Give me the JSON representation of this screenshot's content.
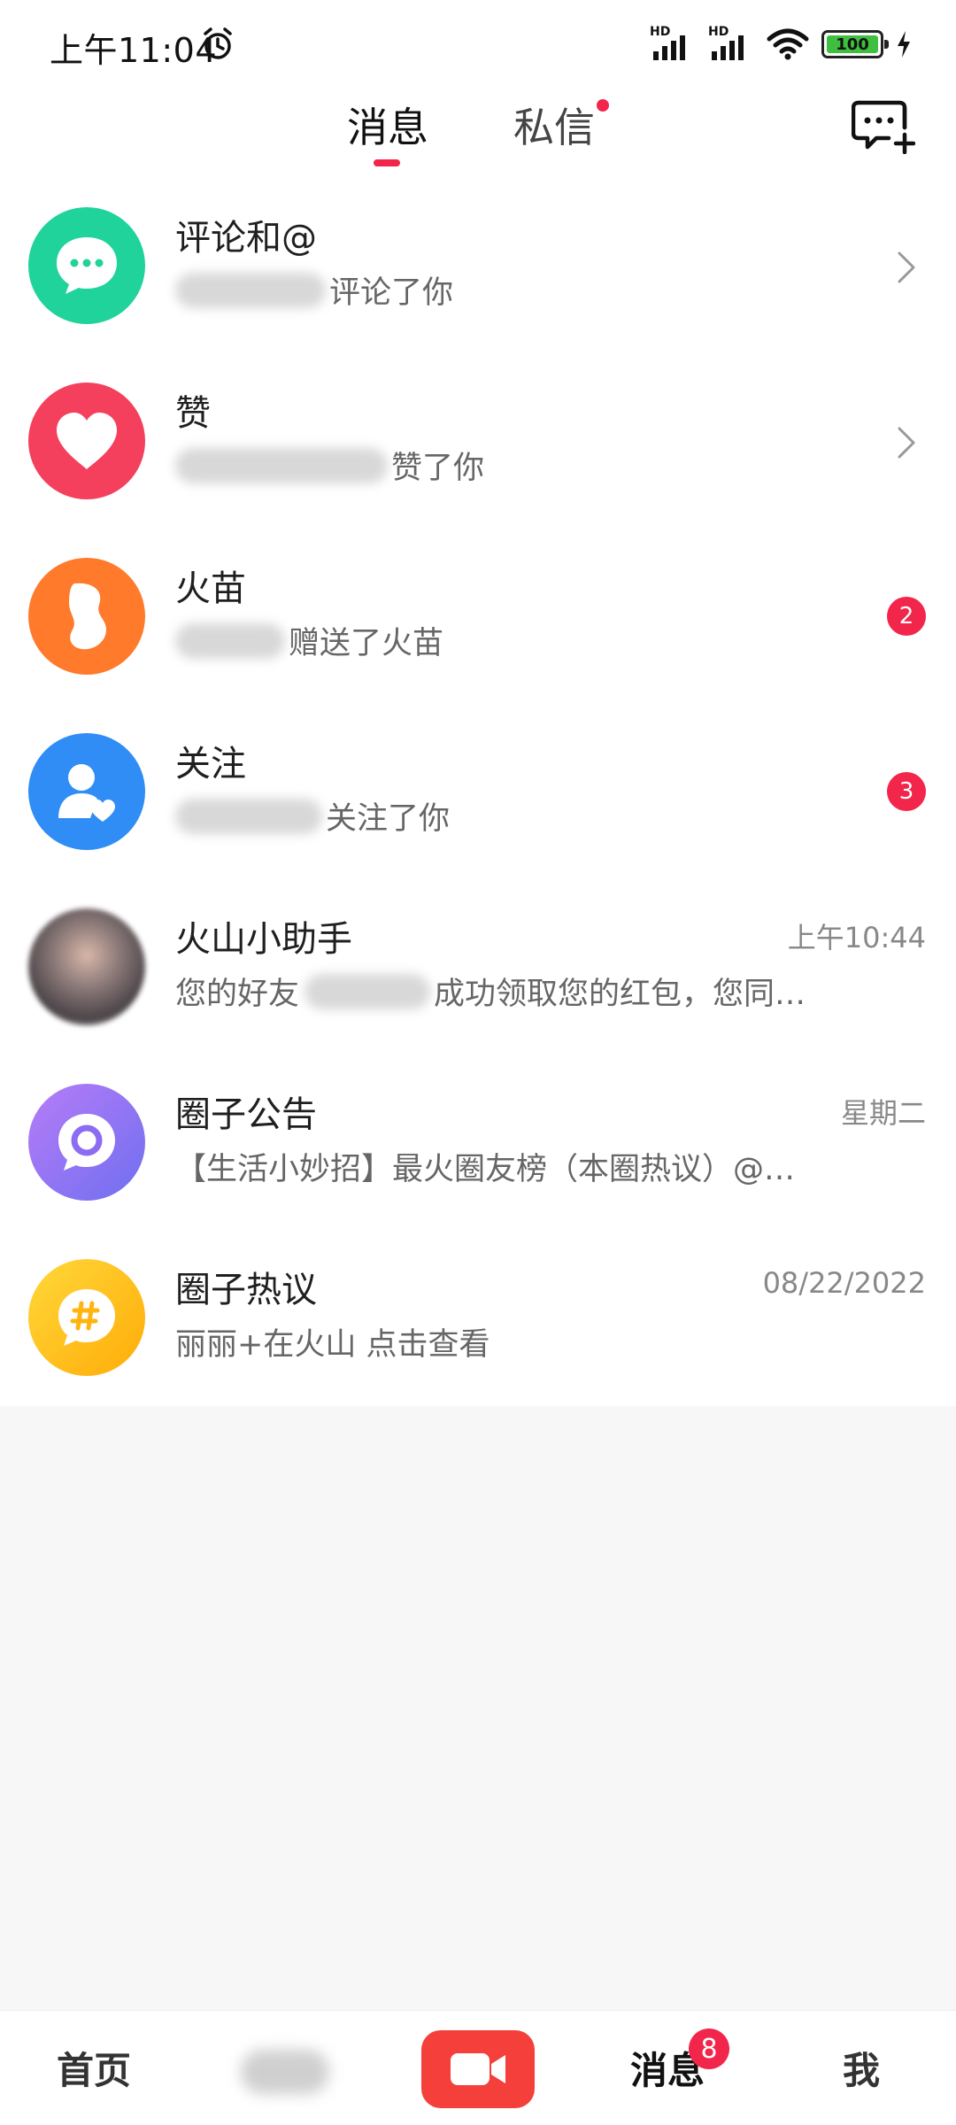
{
  "status_bar": {
    "time": "上午11:04",
    "network_label": "HD",
    "battery_level": "100"
  },
  "header": {
    "tabs": [
      {
        "label": "消息",
        "active": true
      },
      {
        "label": "私信",
        "active": false,
        "has_dot": true
      }
    ]
  },
  "messages": [
    {
      "title": "评论和@",
      "subtitle": "评论了你",
      "icon": "chat-bubble-icon",
      "color": "#1fd39a"
    },
    {
      "title": "赞",
      "subtitle": "赞了你",
      "icon": "heart-icon",
      "color": "#f5405d"
    },
    {
      "title": "火苗",
      "subtitle": "赠送了火苗",
      "icon": "flame-icon",
      "color": "#ff7a2a",
      "badge": "2"
    },
    {
      "title": "关注",
      "subtitle": "关注了你",
      "icon": "follow-user-icon",
      "color": "#2f8df5",
      "badge": "3"
    },
    {
      "title": "火山小助手",
      "subtitle_prefix": "您的好友",
      "subtitle": "成功领取您的红包，您同…",
      "time": "上午10:44"
    },
    {
      "title": "圈子公告",
      "subtitle": "【生活小妙招】最火圈友榜（本圈热议）@…",
      "time": "星期二",
      "icon": "circle-chat-icon",
      "color": "#8b6cf2"
    },
    {
      "title": "圈子热议",
      "subtitle": "丽丽+在火山 点击查看",
      "time": "08/22/2022",
      "icon": "hashtag-chat-icon",
      "color": "#ffc20e"
    }
  ],
  "bottom_nav": {
    "home": "首页",
    "messages": "消息",
    "messages_badge": "8",
    "me": "我"
  },
  "colors": {
    "accent": "#f2254b",
    "record": "#f43f3b"
  }
}
